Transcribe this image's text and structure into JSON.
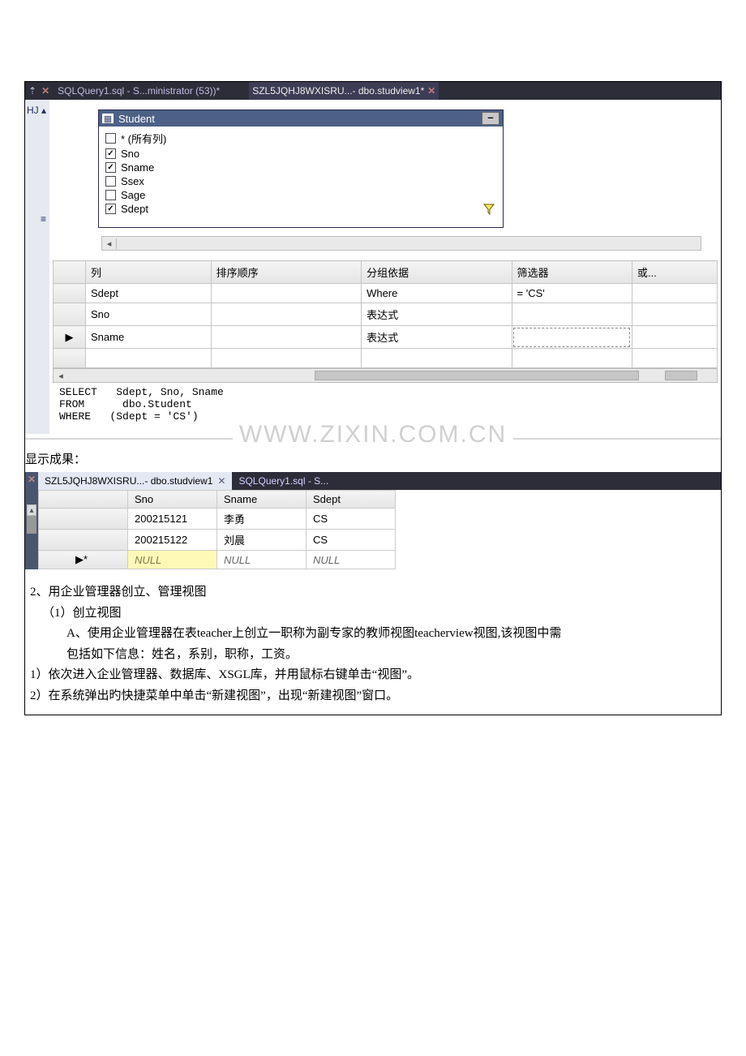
{
  "topTabs": {
    "left": {
      "label": "SQLQuery1.sql - S...ministrator (53))*"
    },
    "right": {
      "label": "SZL5JQHJ8WXISRU...- dbo.studview1*"
    }
  },
  "leftPanel": {
    "topLabel": "HJ ▴",
    "splitIcon": "≡"
  },
  "tableWindow": {
    "title": "Student",
    "columns": [
      {
        "label": "* (所有列)",
        "checked": false,
        "filter": false
      },
      {
        "label": "Sno",
        "checked": true,
        "filter": false
      },
      {
        "label": "Sname",
        "checked": true,
        "filter": false
      },
      {
        "label": "Ssex",
        "checked": false,
        "filter": false
      },
      {
        "label": "Sage",
        "checked": false,
        "filter": false
      },
      {
        "label": "Sdept",
        "checked": true,
        "filter": true
      }
    ]
  },
  "criteria": {
    "headers": {
      "blank": "",
      "col": "列",
      "sort": "排序顺序",
      "group": "分组依据",
      "filter": "筛选器",
      "or": "或..."
    },
    "rows": [
      {
        "marker": "",
        "col": "Sdept",
        "sort": "",
        "group": "Where",
        "filter": "= 'CS'",
        "or": ""
      },
      {
        "marker": "",
        "col": "Sno",
        "sort": "",
        "group": "表达式",
        "filter": "",
        "or": ""
      },
      {
        "marker": "▶",
        "col": "Sname",
        "sort": "",
        "group": "表达式",
        "filter": "",
        "or": "",
        "dashed": true
      },
      {
        "marker": "",
        "col": "",
        "sort": "",
        "group": "",
        "filter": "",
        "or": ""
      }
    ]
  },
  "sql": {
    "line1_kw": "SELECT",
    "line1_rest": "   Sdept, Sno, Sname",
    "line2_kw": "FROM",
    "line2_rest": "      dbo.Student",
    "line3_kw": "WHERE",
    "line3_rest": "   (Sdept = 'CS')"
  },
  "watermark": "WWW.ZIXIN.COM.CN",
  "resultLabel": "显示成果：",
  "resultTabs": {
    "active": "SZL5JQHJ8WXISRU...- dbo.studview1",
    "inactive": "SQLQuery1.sql - S..."
  },
  "results": {
    "headers": [
      "Sno",
      "Sname",
      "Sdept"
    ],
    "rows": [
      {
        "marker": "",
        "cells": [
          "200215121",
          "李勇",
          "CS"
        ]
      },
      {
        "marker": "",
        "cells": [
          "200215122",
          "刘晨",
          "CS"
        ]
      },
      {
        "marker": "▶*",
        "cells": [
          "NULL",
          "NULL",
          "NULL"
        ],
        "null": true
      }
    ]
  },
  "bodyText": {
    "l1": "2、用企业管理器创立、管理视图",
    "l2": "（1）创立视图",
    "l3": "A、使用企业管理器在表teacher上创立一职称为副专家的教师视图teacherview视图,该视图中需",
    "l4": "包括如下信息：姓名，系别，职称，工资。",
    "l5": "1）依次进入企业管理器、数据库、XSGL库，并用鼠标右键单击“视图”。",
    "l6": "2）在系统弹出旳快捷菜单中单击“新建视图”，出现“新建视图”窗口。"
  }
}
